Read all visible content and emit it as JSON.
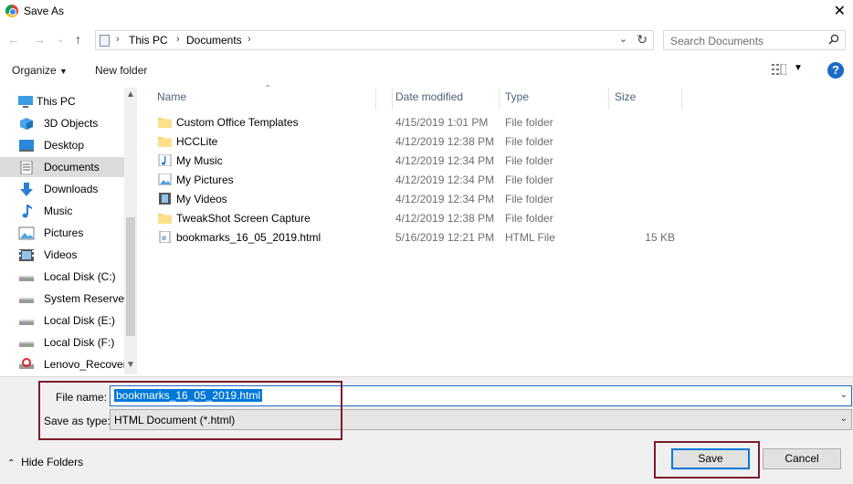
{
  "window": {
    "title": "Save As",
    "app_icon": "chrome-icon"
  },
  "navigation": {
    "breadcrumbs": [
      "This PC",
      "Documents"
    ],
    "search_placeholder": "Search Documents"
  },
  "toolbar": {
    "organize_label": "Organize",
    "new_folder_label": "New folder"
  },
  "sidebar": {
    "items": [
      {
        "label": "This PC",
        "icon": "computer-icon",
        "top": true
      },
      {
        "label": "3D Objects",
        "icon": "cube-icon"
      },
      {
        "label": "Desktop",
        "icon": "desktop-icon"
      },
      {
        "label": "Documents",
        "icon": "document-icon",
        "selected": true
      },
      {
        "label": "Downloads",
        "icon": "download-arrow-icon"
      },
      {
        "label": "Music",
        "icon": "music-note-icon"
      },
      {
        "label": "Pictures",
        "icon": "picture-icon"
      },
      {
        "label": "Videos",
        "icon": "video-icon"
      },
      {
        "label": "Local Disk (C:)",
        "icon": "drive-icon"
      },
      {
        "label": "System Reserved",
        "icon": "drive-icon"
      },
      {
        "label": "Local Disk (E:)",
        "icon": "drive-icon"
      },
      {
        "label": "Local Disk (F:)",
        "icon": "drive-icon"
      },
      {
        "label": "Lenovo_Recovery",
        "icon": "recovery-drive-icon"
      }
    ]
  },
  "filelist": {
    "columns": [
      "Name",
      "Date modified",
      "Type",
      "Size"
    ],
    "rows": [
      {
        "name": "Custom Office Templates",
        "date": "4/15/2019 1:01 PM",
        "type": "File folder",
        "size": "",
        "icon": "folder-icon"
      },
      {
        "name": "HCCLite",
        "date": "4/12/2019 12:38 PM",
        "type": "File folder",
        "size": "",
        "icon": "folder-icon"
      },
      {
        "name": "My Music",
        "date": "4/12/2019 12:34 PM",
        "type": "File folder",
        "size": "",
        "icon": "music-folder-icon"
      },
      {
        "name": "My Pictures",
        "date": "4/12/2019 12:34 PM",
        "type": "File folder",
        "size": "",
        "icon": "pictures-folder-icon"
      },
      {
        "name": "My Videos",
        "date": "4/12/2019 12:34 PM",
        "type": "File folder",
        "size": "",
        "icon": "videos-folder-icon"
      },
      {
        "name": "TweakShot Screen Capture",
        "date": "4/12/2019 12:38 PM",
        "type": "File folder",
        "size": "",
        "icon": "folder-icon"
      },
      {
        "name": "bookmarks_16_05_2019.html",
        "date": "5/16/2019 12:21 PM",
        "type": "HTML File",
        "size": "15 KB",
        "icon": "html-file-icon"
      }
    ]
  },
  "form": {
    "file_name_label": "File name:",
    "file_name_value": "bookmarks_16_05_2019.html",
    "save_type_label": "Save as type:",
    "save_type_value": "HTML Document (*.html)",
    "hide_folders_label": "Hide Folders",
    "save_label": "Save",
    "cancel_label": "Cancel"
  },
  "colors": {
    "accent": "#0078d7",
    "highlight_box": "#7b1c2b",
    "header_text": "#4c607a"
  }
}
